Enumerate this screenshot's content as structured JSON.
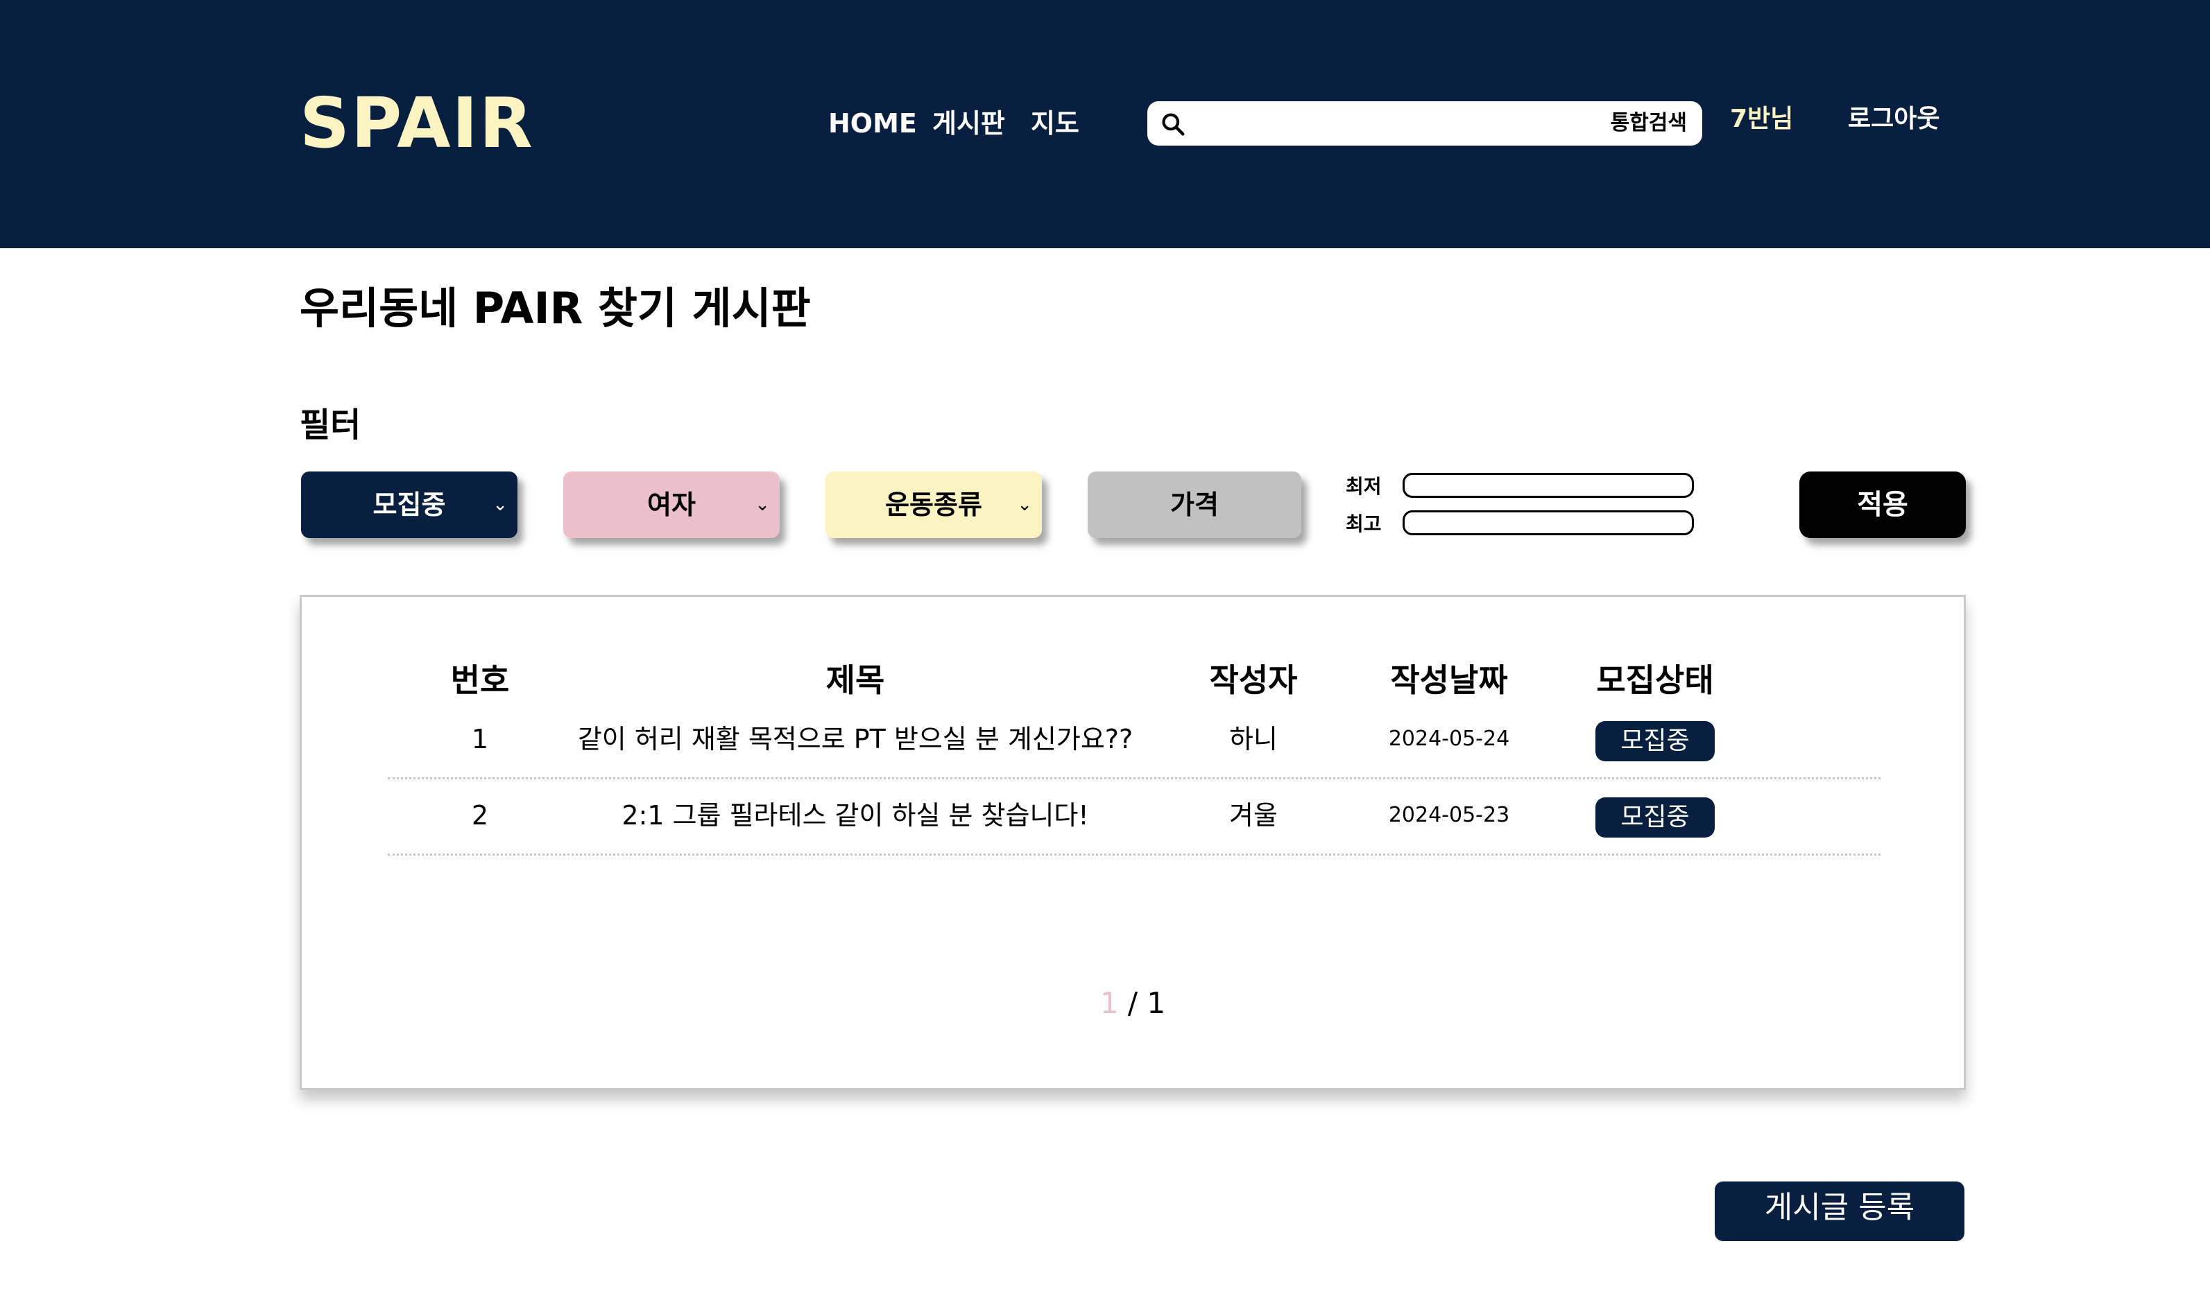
{
  "header": {
    "logo": "SPAIR",
    "nav": {
      "home": "HOME",
      "board": "게시판",
      "map": "지도"
    },
    "search": {
      "placeholder": "",
      "label": "통합검색"
    },
    "user": "7반님",
    "logout": "로그아웃"
  },
  "page_title": "우리동네 PAIR 찾기 게시판",
  "filter": {
    "title": "필터",
    "status": "모집중",
    "gender": "여자",
    "sport": "운동종류",
    "price": "가격",
    "min_label": "최저",
    "max_label": "최고",
    "min_value": "",
    "max_value": "",
    "apply": "적용",
    "chevron": "⌄"
  },
  "table": {
    "headers": [
      "번호",
      "제목",
      "작성자",
      "작성날짜",
      "모집상태"
    ],
    "rows": [
      {
        "no": "1",
        "title": "같이 허리 재활 목적으로 PT 받으실 분 계신가요??",
        "author": "하니",
        "date": "2024-05-24",
        "status": "모집중"
      },
      {
        "no": "2",
        "title": "2:1 그룹 필라테스 같이 하실 분 찾습니다!",
        "author": "겨울",
        "date": "2024-05-23",
        "status": "모집중"
      }
    ]
  },
  "pager": {
    "current": "1",
    "separator": " / ",
    "total": "1"
  },
  "write_button": "게시글 등록",
  "colors": {
    "navy": "#081f3f",
    "cream": "#fbf3c2",
    "pink": "#ecc0cb",
    "gray": "#c1c1c1"
  },
  "icons": {
    "search": "search-icon",
    "dropdown": "chevron-down-icon"
  }
}
